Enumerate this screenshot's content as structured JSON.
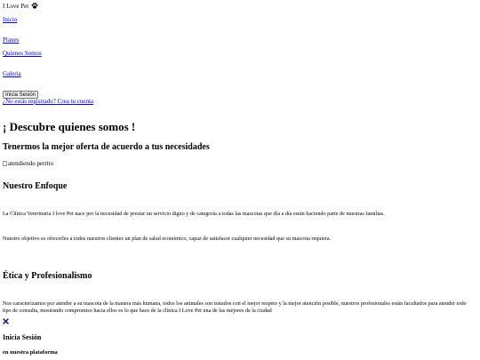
{
  "header": {
    "brand": "I Love Pet",
    "brand_icon": "paw-icon"
  },
  "nav": {
    "items": [
      {
        "label": "Inicio"
      },
      {
        "label": "Planes"
      },
      {
        "label": "Quienes Somos"
      },
      {
        "label": "Galeria"
      }
    ],
    "login_button": "Inicia Sesión",
    "register_link": "¿No estás registrado? Crea tu cuenta"
  },
  "main": {
    "title": "¡ Descubre quienes somos !",
    "subtitle": "Tenermos la mejor oferta de acuerdo a tus necesidades",
    "image_alt": "atendiendo perrito",
    "enfoque": {
      "heading": "Nuestro Enfoque",
      "paragraph1": "La Clínica Veterinaria I love Pet nace por la necesidad de prestar un servicio digno y de categoría a todas las mascotas que día a día están haciendo parte de nuestras familias.",
      "paragraph2": "Nuestro objetivo es ofrecerles a todos nuestros clientes un plan de salud económico, capaz de satisfacer cualquier necesidad que su mascota requiera."
    },
    "etica": {
      "heading": "Ética y Profesionalismo",
      "paragraph": "Nos caracterizamos por atender a su mascota de la manera más humana, todos los animales son tratados con el mejor respeto y la mejor atención posible, nuestros profesionales están facultados para atender todo tipo de consulta, mostrando compromiso hacia ellos es lo que hace de la clínica I Love Pet una de las mejores de la ciudad"
    }
  },
  "modal": {
    "close_icon": "close-icon",
    "close_color": "#1a237e",
    "title": "Inicia Sesión",
    "subtitle": "en nuestra plataforma"
  }
}
